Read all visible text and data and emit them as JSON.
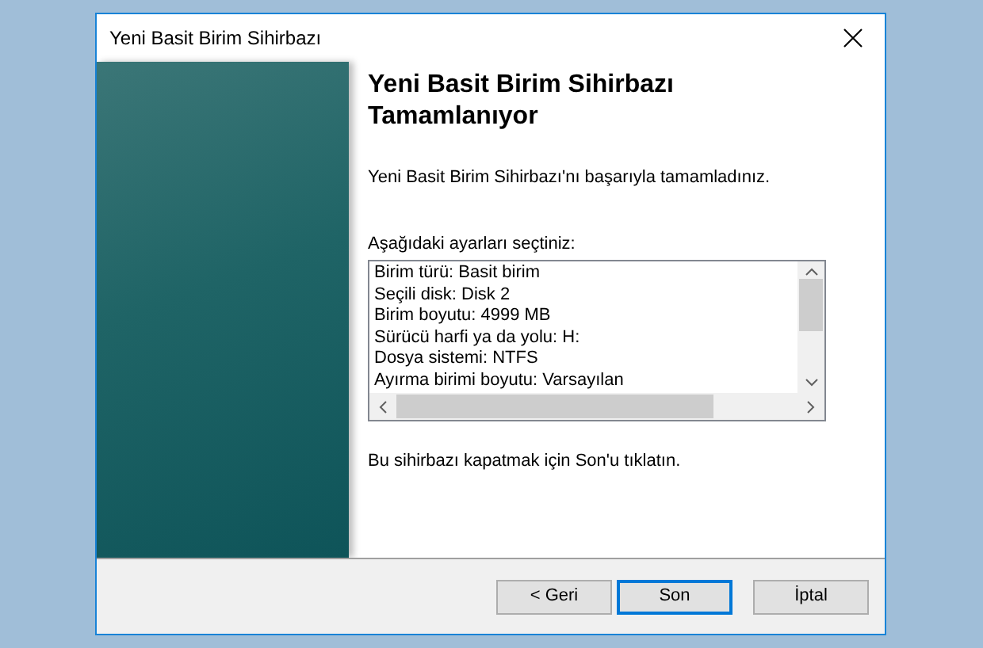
{
  "window": {
    "title": "Yeni Basit Birim Sihirbazı"
  },
  "heading": "Yeni Basit Birim Sihirbazı Tamamlanıyor",
  "intro": "Yeni Basit Birim Sihirbazı'nı başarıyla tamamladınız.",
  "settings": {
    "label": "Aşağıdaki ayarları seçtiniz:",
    "lines": [
      "Birim türü: Basit birim",
      "Seçili disk: Disk 2",
      "Birim boyutu: 4999 MB",
      "Sürücü harfi ya da yolu: H:",
      "Dosya sistemi: NTFS",
      "Ayırma birimi boyutu: Varsayılan"
    ]
  },
  "footer_note": "Bu sihirbazı kapatmak için Son'u tıklatın.",
  "buttons": [
    {
      "label": "< Geri",
      "default": false
    },
    {
      "label": "Son",
      "default": true
    },
    {
      "label": "İptal",
      "default": false
    }
  ]
}
